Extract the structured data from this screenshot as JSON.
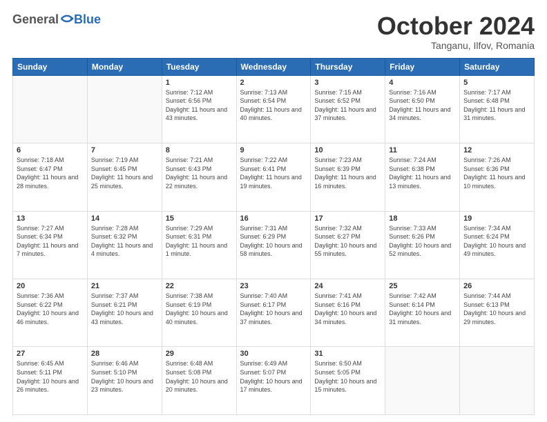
{
  "header": {
    "logo_general": "General",
    "logo_blue": "Blue",
    "month": "October 2024",
    "location": "Tanganu, Ilfov, Romania"
  },
  "weekdays": [
    "Sunday",
    "Monday",
    "Tuesday",
    "Wednesday",
    "Thursday",
    "Friday",
    "Saturday"
  ],
  "weeks": [
    [
      {
        "day": "",
        "sunrise": "",
        "sunset": "",
        "daylight": ""
      },
      {
        "day": "",
        "sunrise": "",
        "sunset": "",
        "daylight": ""
      },
      {
        "day": "1",
        "sunrise": "Sunrise: 7:12 AM",
        "sunset": "Sunset: 6:56 PM",
        "daylight": "Daylight: 11 hours and 43 minutes."
      },
      {
        "day": "2",
        "sunrise": "Sunrise: 7:13 AM",
        "sunset": "Sunset: 6:54 PM",
        "daylight": "Daylight: 11 hours and 40 minutes."
      },
      {
        "day": "3",
        "sunrise": "Sunrise: 7:15 AM",
        "sunset": "Sunset: 6:52 PM",
        "daylight": "Daylight: 11 hours and 37 minutes."
      },
      {
        "day": "4",
        "sunrise": "Sunrise: 7:16 AM",
        "sunset": "Sunset: 6:50 PM",
        "daylight": "Daylight: 11 hours and 34 minutes."
      },
      {
        "day": "5",
        "sunrise": "Sunrise: 7:17 AM",
        "sunset": "Sunset: 6:48 PM",
        "daylight": "Daylight: 11 hours and 31 minutes."
      }
    ],
    [
      {
        "day": "6",
        "sunrise": "Sunrise: 7:18 AM",
        "sunset": "Sunset: 6:47 PM",
        "daylight": "Daylight: 11 hours and 28 minutes."
      },
      {
        "day": "7",
        "sunrise": "Sunrise: 7:19 AM",
        "sunset": "Sunset: 6:45 PM",
        "daylight": "Daylight: 11 hours and 25 minutes."
      },
      {
        "day": "8",
        "sunrise": "Sunrise: 7:21 AM",
        "sunset": "Sunset: 6:43 PM",
        "daylight": "Daylight: 11 hours and 22 minutes."
      },
      {
        "day": "9",
        "sunrise": "Sunrise: 7:22 AM",
        "sunset": "Sunset: 6:41 PM",
        "daylight": "Daylight: 11 hours and 19 minutes."
      },
      {
        "day": "10",
        "sunrise": "Sunrise: 7:23 AM",
        "sunset": "Sunset: 6:39 PM",
        "daylight": "Daylight: 11 hours and 16 minutes."
      },
      {
        "day": "11",
        "sunrise": "Sunrise: 7:24 AM",
        "sunset": "Sunset: 6:38 PM",
        "daylight": "Daylight: 11 hours and 13 minutes."
      },
      {
        "day": "12",
        "sunrise": "Sunrise: 7:26 AM",
        "sunset": "Sunset: 6:36 PM",
        "daylight": "Daylight: 11 hours and 10 minutes."
      }
    ],
    [
      {
        "day": "13",
        "sunrise": "Sunrise: 7:27 AM",
        "sunset": "Sunset: 6:34 PM",
        "daylight": "Daylight: 11 hours and 7 minutes."
      },
      {
        "day": "14",
        "sunrise": "Sunrise: 7:28 AM",
        "sunset": "Sunset: 6:32 PM",
        "daylight": "Daylight: 11 hours and 4 minutes."
      },
      {
        "day": "15",
        "sunrise": "Sunrise: 7:29 AM",
        "sunset": "Sunset: 6:31 PM",
        "daylight": "Daylight: 11 hours and 1 minute."
      },
      {
        "day": "16",
        "sunrise": "Sunrise: 7:31 AM",
        "sunset": "Sunset: 6:29 PM",
        "daylight": "Daylight: 10 hours and 58 minutes."
      },
      {
        "day": "17",
        "sunrise": "Sunrise: 7:32 AM",
        "sunset": "Sunset: 6:27 PM",
        "daylight": "Daylight: 10 hours and 55 minutes."
      },
      {
        "day": "18",
        "sunrise": "Sunrise: 7:33 AM",
        "sunset": "Sunset: 6:26 PM",
        "daylight": "Daylight: 10 hours and 52 minutes."
      },
      {
        "day": "19",
        "sunrise": "Sunrise: 7:34 AM",
        "sunset": "Sunset: 6:24 PM",
        "daylight": "Daylight: 10 hours and 49 minutes."
      }
    ],
    [
      {
        "day": "20",
        "sunrise": "Sunrise: 7:36 AM",
        "sunset": "Sunset: 6:22 PM",
        "daylight": "Daylight: 10 hours and 46 minutes."
      },
      {
        "day": "21",
        "sunrise": "Sunrise: 7:37 AM",
        "sunset": "Sunset: 6:21 PM",
        "daylight": "Daylight: 10 hours and 43 minutes."
      },
      {
        "day": "22",
        "sunrise": "Sunrise: 7:38 AM",
        "sunset": "Sunset: 6:19 PM",
        "daylight": "Daylight: 10 hours and 40 minutes."
      },
      {
        "day": "23",
        "sunrise": "Sunrise: 7:40 AM",
        "sunset": "Sunset: 6:17 PM",
        "daylight": "Daylight: 10 hours and 37 minutes."
      },
      {
        "day": "24",
        "sunrise": "Sunrise: 7:41 AM",
        "sunset": "Sunset: 6:16 PM",
        "daylight": "Daylight: 10 hours and 34 minutes."
      },
      {
        "day": "25",
        "sunrise": "Sunrise: 7:42 AM",
        "sunset": "Sunset: 6:14 PM",
        "daylight": "Daylight: 10 hours and 31 minutes."
      },
      {
        "day": "26",
        "sunrise": "Sunrise: 7:44 AM",
        "sunset": "Sunset: 6:13 PM",
        "daylight": "Daylight: 10 hours and 29 minutes."
      }
    ],
    [
      {
        "day": "27",
        "sunrise": "Sunrise: 6:45 AM",
        "sunset": "Sunset: 5:11 PM",
        "daylight": "Daylight: 10 hours and 26 minutes."
      },
      {
        "day": "28",
        "sunrise": "Sunrise: 6:46 AM",
        "sunset": "Sunset: 5:10 PM",
        "daylight": "Daylight: 10 hours and 23 minutes."
      },
      {
        "day": "29",
        "sunrise": "Sunrise: 6:48 AM",
        "sunset": "Sunset: 5:08 PM",
        "daylight": "Daylight: 10 hours and 20 minutes."
      },
      {
        "day": "30",
        "sunrise": "Sunrise: 6:49 AM",
        "sunset": "Sunset: 5:07 PM",
        "daylight": "Daylight: 10 hours and 17 minutes."
      },
      {
        "day": "31",
        "sunrise": "Sunrise: 6:50 AM",
        "sunset": "Sunset: 5:05 PM",
        "daylight": "Daylight: 10 hours and 15 minutes."
      },
      {
        "day": "",
        "sunrise": "",
        "sunset": "",
        "daylight": ""
      },
      {
        "day": "",
        "sunrise": "",
        "sunset": "",
        "daylight": ""
      }
    ]
  ]
}
